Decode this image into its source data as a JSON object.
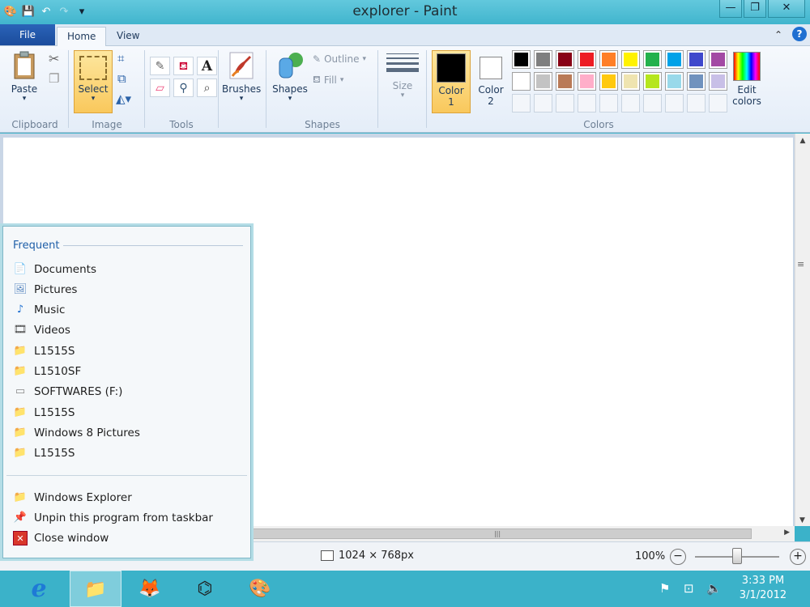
{
  "window": {
    "title": "explorer - Paint"
  },
  "tabs": {
    "file": "File",
    "home": "Home",
    "view": "View"
  },
  "ribbon": {
    "paste": "Paste",
    "select": "Select",
    "outline": "Outline",
    "fill": "Fill",
    "brushes": "Brushes",
    "shapes": "Shapes",
    "size": "Size",
    "color1_a": "Color",
    "color1_b": "1",
    "color2_a": "Color",
    "color2_b": "2",
    "edit_a": "Edit",
    "edit_b": "colors",
    "groups": {
      "clipboard": "Clipboard",
      "image": "Image",
      "tools": "Tools",
      "shapes": "Shapes",
      "colors": "Colors"
    }
  },
  "palette": {
    "row1": [
      "#000000",
      "#7f7f7f",
      "#880015",
      "#ed1c24",
      "#ff7f27",
      "#fff200",
      "#22b14c",
      "#00a2e8",
      "#3f48cc",
      "#a349a4"
    ],
    "row2": [
      "#ffffff",
      "#c3c3c3",
      "#b97a57",
      "#ffaec9",
      "#ffc90e",
      "#efe4b0",
      "#b5e61d",
      "#99d9ea",
      "#7092be",
      "#c8bfe7"
    ]
  },
  "status": {
    "dimensions": "1024 × 768px",
    "zoom": "100%"
  },
  "jumplist": {
    "heading": "Frequent",
    "items": [
      {
        "label": "Documents",
        "icon": "documents-icon"
      },
      {
        "label": "Pictures",
        "icon": "pictures-icon"
      },
      {
        "label": "Music",
        "icon": "music-icon"
      },
      {
        "label": "Videos",
        "icon": "videos-icon"
      },
      {
        "label": "L1515S",
        "icon": "folder-icon"
      },
      {
        "label": "L1510SF",
        "icon": "folder-icon"
      },
      {
        "label": "SOFTWARES (F:)",
        "icon": "drive-icon"
      },
      {
        "label": "L1515S",
        "icon": "folder-icon"
      },
      {
        "label": "Windows 8 Pictures",
        "icon": "folder-icon"
      },
      {
        "label": "L1515S",
        "icon": "folder-icon"
      }
    ],
    "tasks": [
      {
        "label": "Windows Explorer",
        "icon": "explorer-icon"
      },
      {
        "label": "Unpin this program from taskbar",
        "icon": "unpin-icon"
      },
      {
        "label": "Close window",
        "icon": "close-window-icon"
      }
    ]
  },
  "clock": {
    "time": "3:33 PM",
    "date": "3/1/2012"
  }
}
